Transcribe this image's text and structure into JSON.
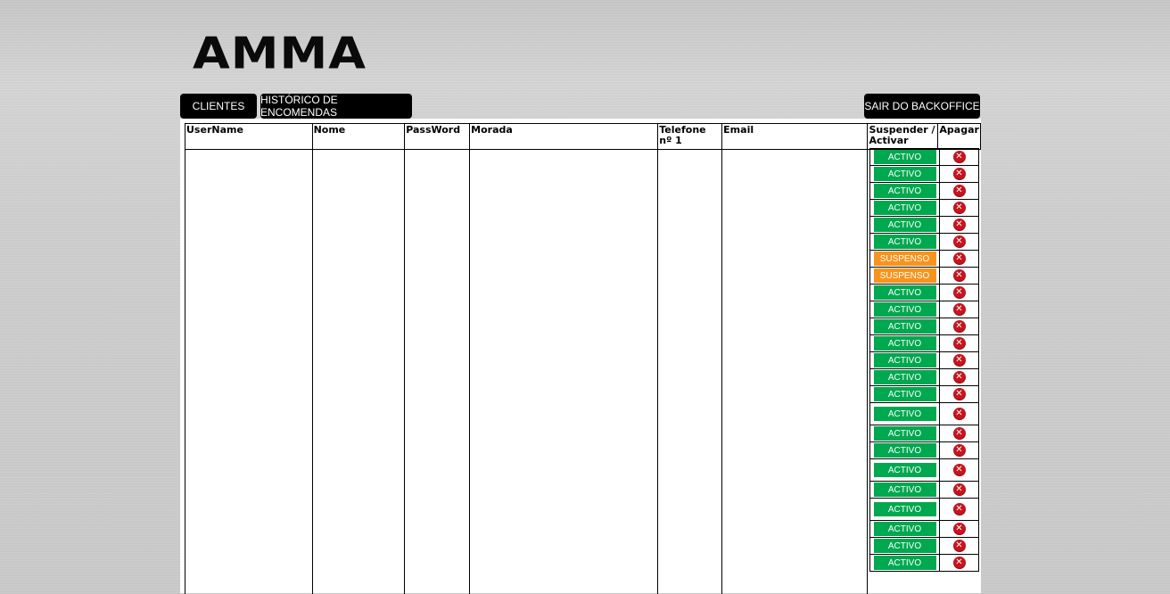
{
  "brand": {
    "logo_text": "AMMA"
  },
  "nav": {
    "clients_label": "CLIENTES",
    "orders_history_label": "HISTÓRICO DE ENCOMENDAS",
    "logout_label": "SAIR DO BACKOFFICE"
  },
  "table": {
    "headers": {
      "username": "UserName",
      "name": "Nome",
      "password": "PassWord",
      "address": "Morada",
      "phone": "Telefone nº 1",
      "email": "Email",
      "suspend": "Suspender / Activar",
      "delete": "Apagar"
    },
    "rows": [
      {
        "status": "ACTIVO"
      },
      {
        "status": "ACTIVO"
      },
      {
        "status": "ACTIVO"
      },
      {
        "status": "ACTIVO"
      },
      {
        "status": "ACTIVO"
      },
      {
        "status": "ACTIVO"
      },
      {
        "status": "SUSPENSO"
      },
      {
        "status": "SUSPENSO"
      },
      {
        "status": "ACTIVO"
      },
      {
        "status": "ACTIVO"
      },
      {
        "status": "ACTIVO"
      },
      {
        "status": "ACTIVO"
      },
      {
        "status": "ACTIVO"
      },
      {
        "status": "ACTIVO"
      },
      {
        "status": "ACTIVO"
      },
      {
        "status": "ACTIVO"
      },
      {
        "status": "ACTIVO"
      },
      {
        "status": "ACTIVO"
      },
      {
        "status": "ACTIVO"
      },
      {
        "status": "ACTIVO"
      },
      {
        "status": "ACTIVO"
      },
      {
        "status": "ACTIVO"
      },
      {
        "status": "ACTIVO"
      },
      {
        "status": "ACTIVO"
      }
    ],
    "delete_icon": "delete-x-icon"
  },
  "colors": {
    "active": "#00a84f",
    "suspended": "#f7941d",
    "delete": "#c8141e",
    "nav_bg": "#000000"
  }
}
